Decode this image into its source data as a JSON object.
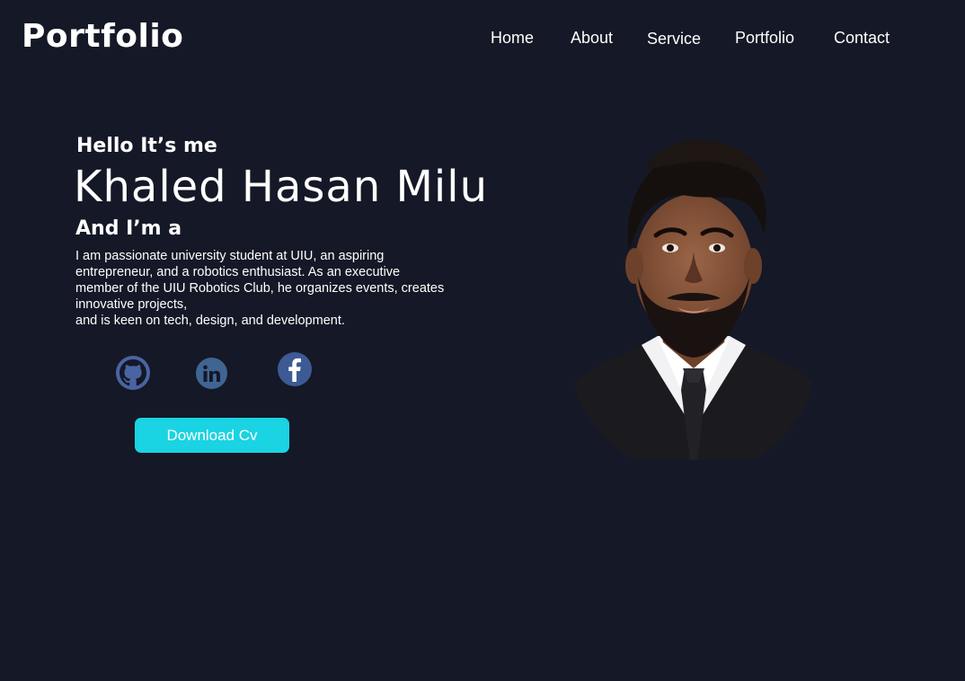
{
  "header": {
    "logo": "Portfolio",
    "nav": [
      "Home",
      "About",
      "Service",
      "Portfolio",
      "Contact"
    ]
  },
  "hero": {
    "greeting": "Hello It’s me",
    "name": "Khaled Hasan Milu",
    "role_prefix": "And I’m a",
    "bio_lines": [
      "I am passionate university student at UIU, an aspiring",
      "entrepreneur, and a robotics enthusiast. As an executive",
      "member of the UIU Robotics Club, he organizes events, creates",
      "innovative projects,",
      "and is keen on tech, design, and development."
    ],
    "socials": [
      {
        "name": "github",
        "icon": "github-icon",
        "color": "#4a64a3"
      },
      {
        "name": "linkedin",
        "icon": "linkedin-icon",
        "color": "#3f6592"
      },
      {
        "name": "facebook",
        "icon": "facebook-icon",
        "color": "#3e5a94"
      }
    ],
    "download_label": "Download Cv"
  },
  "colors": {
    "background": "#151826",
    "accent": "#1ad3e3",
    "text": "#ffffff"
  }
}
